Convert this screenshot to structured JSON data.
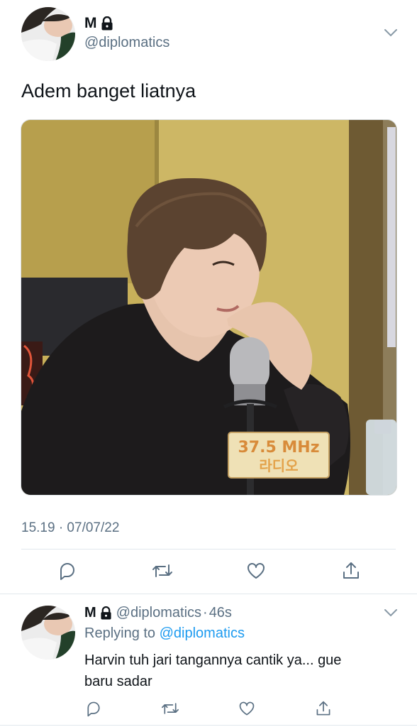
{
  "tweet": {
    "display_name": "M",
    "handle": "@diplomatics",
    "lock_icon": "lock-icon",
    "text": "Adem banget liatnya",
    "timestamp": "15.19 · 07/07/22",
    "media_sign": {
      "line1": "37.5 MHz",
      "line2": "라디오"
    }
  },
  "actions": [
    "reply-icon",
    "retweet-icon",
    "like-icon",
    "share-icon"
  ],
  "reply": {
    "display_name": "M",
    "handle": "@diplomatics",
    "age": "46s",
    "replying_prefix": "Replying to ",
    "replying_to": "@diplomatics",
    "text_line1": "Harvin tuh jari tangannya cantik ya... gue",
    "text_line2": "baru sadar"
  },
  "colors": {
    "link": "#1d9bf0",
    "muted": "#5b7083",
    "text": "#0f1419",
    "divider": "#e1e8ed"
  }
}
